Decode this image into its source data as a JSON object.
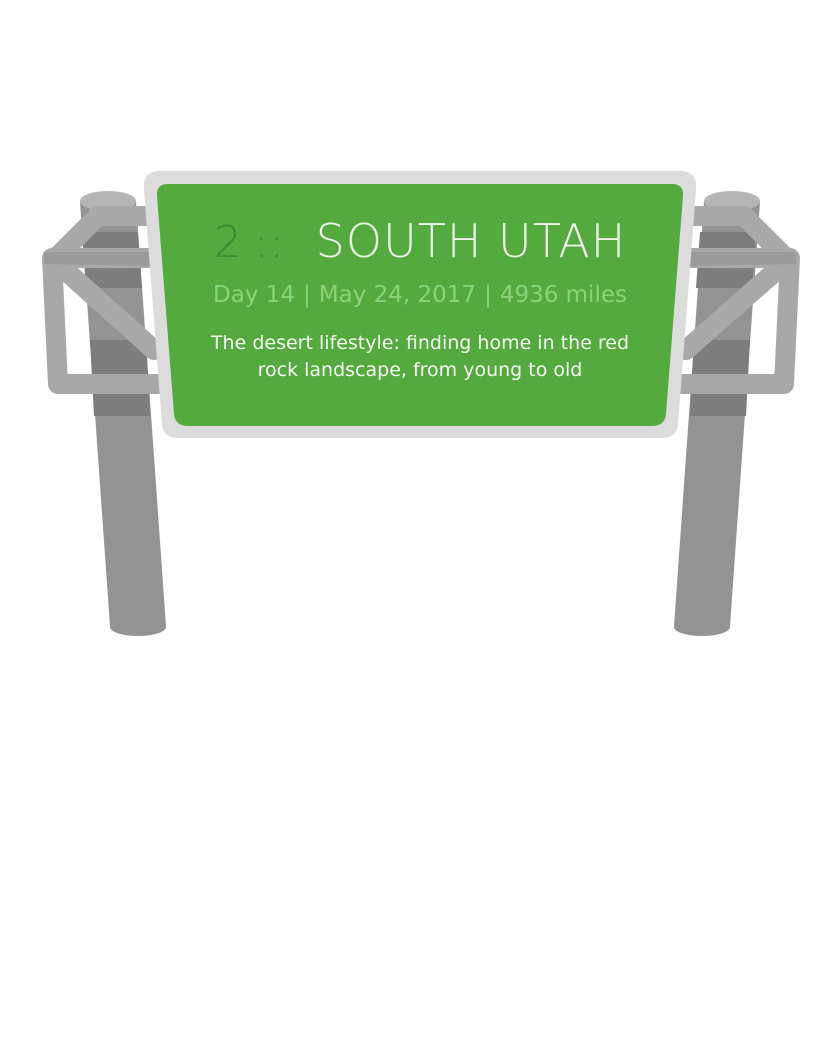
{
  "sign": {
    "chapter_number": "2",
    "separator": "::",
    "place": "SOUTH UTAH",
    "day": "Day 14",
    "date": "May 24, 2017",
    "miles": "4936 miles",
    "divider": "|",
    "description": "The desert lifestyle: finding home in the red rock landscape, from young to old"
  },
  "colors": {
    "sign_green": "#54a93f",
    "sign_frame": "#dcdcdc",
    "post_gray": "#939393",
    "number_green": "#3b8a34",
    "subline_green": "#8cd27a"
  }
}
